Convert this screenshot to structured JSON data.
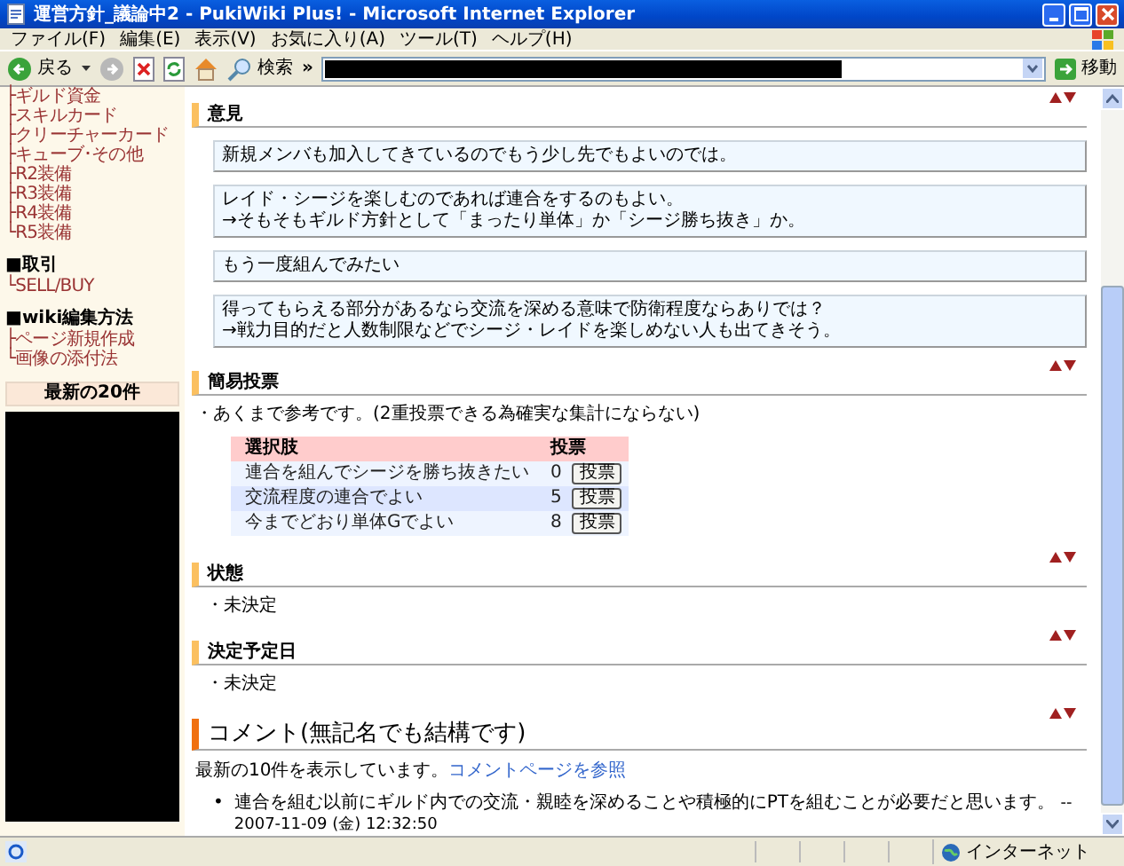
{
  "window": {
    "title": "運営方針_議論中2 - PukiWiki Plus! - Microsoft Internet Explorer"
  },
  "menu": [
    "ファイル(F)",
    "編集(E)",
    "表示(V)",
    "お気に入り(A)",
    "ツール(T)",
    "ヘルプ(H)"
  ],
  "toolbar": {
    "back": "戻る",
    "search": "検索",
    "more": "»",
    "go": "移動"
  },
  "sidebar": {
    "groups": [
      {
        "items": [
          "├ギルド資金",
          "├スキルカード",
          "├クリーチャーカード",
          "├キューブ･その他",
          "├R2装備",
          "├R3装備",
          "├R4装備",
          "└R5装備"
        ]
      },
      {
        "heading": "■取引",
        "items": [
          "└SELL/BUY"
        ]
      },
      {
        "heading": "■wiki編集方法",
        "items": [
          "├ページ新規作成",
          "└画像の添付法"
        ]
      }
    ],
    "recent_title": "最新の20件"
  },
  "sections": [
    {
      "kind": "opinions",
      "heading": "意見",
      "opinions": [
        [
          "新規メンバも加入してきているのでもう少し先でもよいのでは。"
        ],
        [
          "レイド・シージを楽しむのであれば連合をするのもよい。",
          "→そもそもギルド方針として「まったり単体」か「シージ勝ち抜き」か。"
        ],
        [
          "もう一度組んでみたい"
        ],
        [
          "得ってもらえる部分があるなら交流を深める意味で防衛程度ならありでは？",
          "→戦力目的だと人数制限などでシージ・レイドを楽しめない人も出てきそう。"
        ]
      ]
    },
    {
      "kind": "vote",
      "heading": "簡易投票",
      "note": "・あくまで参考です。(2重投票できる為確実な集計にならない)",
      "columns": [
        "選択肢",
        "投票"
      ],
      "options": [
        {
          "label": "連合を組んでシージを勝ち抜きたい",
          "count": "0",
          "button": "投票"
        },
        {
          "label": "交流程度の連合でよい",
          "count": "5",
          "button": "投票"
        },
        {
          "label": "今までどおり単体Gでよい",
          "count": "8",
          "button": "投票"
        }
      ]
    },
    {
      "kind": "bullet",
      "heading": "状態",
      "text": "・未決定"
    },
    {
      "kind": "bullet",
      "heading": "決定予定日",
      "text": "・未決定"
    },
    {
      "kind": "comments",
      "heading": "コメント(無記名でも結構です)",
      "intro": "最新の10件を表示しています。",
      "link": "コメントページを参照",
      "comments": [
        {
          "marker": "•",
          "text": "連合を組む以前にギルド内での交流・親睦を深めることや積極的にPTを組むことが必要だと思います。",
          "signature": "-- 2007-11-09 (金) 12:32:50"
        }
      ]
    }
  ],
  "status_bar": {
    "zone": "インターネット"
  }
}
